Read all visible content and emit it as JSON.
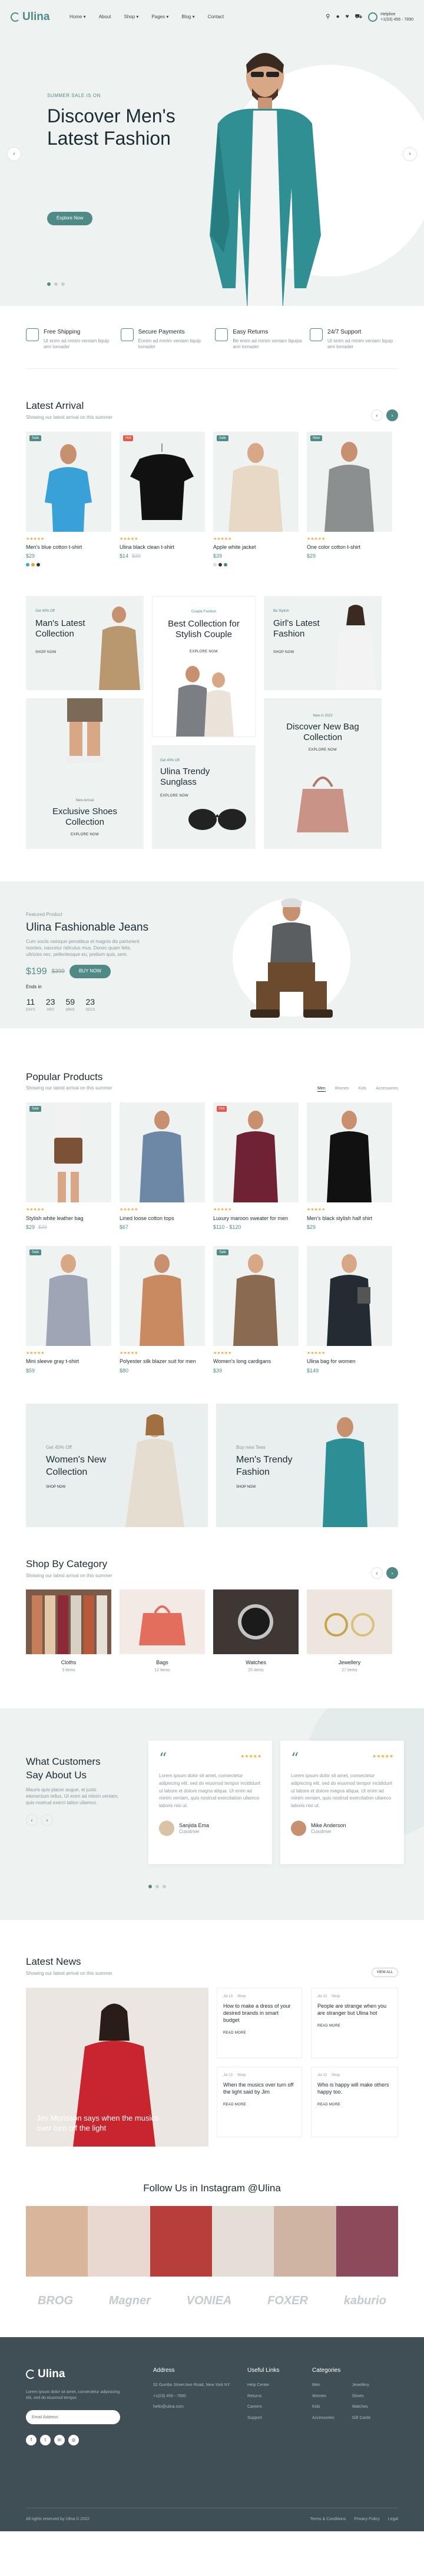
{
  "header": {
    "logo": "Ulina",
    "nav": [
      "Home ▾",
      "About",
      "Shop ▾",
      "Pages ▾",
      "Blog ▾",
      "Contact"
    ],
    "icons": [
      "search-icon",
      "user-icon",
      "heart-icon",
      "cart-icon"
    ],
    "cart_count": "0",
    "help_label": "Helpline",
    "help_phone": "+1(03) 456 - 7890"
  },
  "hero": {
    "subtitle": "SUMMER SALE IS ON",
    "title": "Discover Men's Latest Fashion",
    "button": "Explore Now"
  },
  "features": [
    {
      "title": "Free Shipping",
      "text": "Ut enim ad minim veniam liquip ami tomader"
    },
    {
      "title": "Secure Payments",
      "text": "Eonim ad minim veniam liquip tomader"
    },
    {
      "title": "Easy Returns",
      "text": "Be enim ad minim veniam liquipa ami tomader"
    },
    {
      "title": "24/7 Support",
      "text": "Ut enim ad minim veniam liquip ami tomader"
    }
  ],
  "latest": {
    "title": "Latest Arrival",
    "sub": "Showing our latest arrival on this summer",
    "products": [
      {
        "name": "Men's blue cotton t-shirt",
        "price": "$29",
        "old": "",
        "badge": "Sale",
        "badge_red": false
      },
      {
        "name": "Ulina black clean t-shirt",
        "price": "$14",
        "old": "$30",
        "badge": "Hot",
        "badge_red": true
      },
      {
        "name": "Apple white jacket",
        "price": "$39",
        "old": "",
        "badge": "Sale",
        "badge_red": false
      },
      {
        "name": "One color cotton t-shirt",
        "price": "$29",
        "old": "",
        "badge": "New",
        "badge_red": false
      }
    ]
  },
  "collections": {
    "mens_tag": "Get 40% Off",
    "mens": "Man's Latest Collection",
    "shop": "SHOP NOW",
    "couple_tag": "Couple Fashion",
    "couple": "Best Collection for Stylish Couple",
    "explore": "EXPLORE NOW",
    "girls_tag": "Be Stylish",
    "girls": "Girl's Latest Fashion",
    "shop2": "SHOP NOW",
    "shoes_tag": "New Arrival",
    "shoes": "Exclusive Shoes Collection",
    "explore2": "EXPLORE NOW",
    "sun_tag": "Get 40% Off",
    "sun": "Ulina Trendy Sunglass",
    "explore3": "EXPLORE NOW",
    "bag_tag": "New in 2022",
    "bag": "Discover New Bag Collection",
    "explore4": "EXPLORE NOW"
  },
  "jeans": {
    "tag": "Featured Product",
    "title": "Ulina Fashionable Jeans",
    "text": "Cum sociis natoque penatibus et magnis dis parturient montes, nascetur ridiculus mus. Donec quam felis, ultricies nec, pellentesque eu, pretium quis, sem.",
    "price": "$199",
    "old": "$399",
    "button": "BUY NOW",
    "ends": "Ends in",
    "cd": [
      {
        "n": "11",
        "u": "DAYS"
      },
      {
        "n": "23",
        "u": "HRS"
      },
      {
        "n": "59",
        "u": "MINS"
      },
      {
        "n": "23",
        "u": "SECS"
      }
    ]
  },
  "popular": {
    "title": "Popular Products",
    "sub": "Showing our latest arrival on this summer",
    "tabs": [
      "Men",
      "Women",
      "Kids",
      "Accessories"
    ],
    "products": [
      {
        "name": "Stylish white leather bag",
        "price": "$29",
        "old": "$39",
        "badge": "Sale",
        "badge_red": false
      },
      {
        "name": "Lined loose cotton tops",
        "price": "$67",
        "old": "",
        "badge": "",
        "badge_red": false
      },
      {
        "name": "Luxury maroon sweater for men",
        "price": "$110 - $120",
        "old": "",
        "badge": "Hot",
        "badge_red": true
      },
      {
        "name": "Men's black stylish half shirt",
        "price": "$29",
        "old": "",
        "badge": "",
        "badge_red": false
      },
      {
        "name": "Mini sleeve gray t-shirt",
        "price": "$59",
        "old": "",
        "badge": "Sale",
        "badge_red": false
      },
      {
        "name": "Polyester silk blazer suit for men",
        "price": "$80",
        "old": "",
        "badge": "",
        "badge_red": false
      },
      {
        "name": "Women's long cardigans",
        "price": "$39",
        "old": "",
        "badge": "Sale",
        "badge_red": false
      },
      {
        "name": "Ulina bag for women",
        "price": "$149",
        "old": "",
        "badge": "",
        "badge_red": false
      }
    ]
  },
  "banners": [
    {
      "tag": "Get 40% Off",
      "title": "Women's New Collection",
      "link": "SHOP NOW"
    },
    {
      "tag": "Buy new Tees",
      "title": "Men's Trendy Fashion",
      "link": "SHOP NOW"
    }
  ],
  "categories": {
    "title": "Shop By Category",
    "sub": "Showing our latest arrival on this summer",
    "items": [
      {
        "label": "Cloths",
        "sub": "3 items"
      },
      {
        "label": "Bags",
        "sub": "12 items"
      },
      {
        "label": "Watches",
        "sub": "25 items"
      },
      {
        "label": "Jewellery",
        "sub": "27 items"
      }
    ]
  },
  "testimonials": {
    "title": "What Customers Say About Us",
    "text": "Mauris quis placer augue, et justo elementum tellus. Ut enim ad minim veniam, quis nostrud exerci tation ullamco.",
    "items": [
      {
        "text": "Lorem ipsum dolor sit amet, consectetur adipiscing elit, sed do eiusmod tempor incididunt ut labore et dolore magna aliqua. Ut enim ad minim veniam, quis nostrud exercitation ullamco laboris nisi ut.",
        "name": "Sanjida Ema",
        "role": "Cusotmer"
      },
      {
        "text": "Lorem ipsum dolor sit amet, consectetur adipiscing elit, sed do eiusmod tempor incididunt ut labore et dolore magna aliqua. Ut enim ad minim veniam, quis nostrud exercitation ullamco laboris nisi ut.",
        "name": "Mike Anderson",
        "role": "Cusotmer"
      }
    ]
  },
  "news": {
    "title": "Latest News",
    "sub": "Showing our latest arrival on this summer",
    "view": "VIEW ALL",
    "big": "Jim Morisson says when the musics over turn off the light",
    "items": [
      {
        "date": "Jul 13",
        "cat": "Shop",
        "title": "How to make a dress of your desired brands in smart budget",
        "read": "READ MORE"
      },
      {
        "date": "Jul 13",
        "cat": "Shop",
        "title": "People are strange when you are stranger but Ulina hot",
        "read": "READ MORE"
      },
      {
        "date": "Jul 13",
        "cat": "Shop",
        "title": "When the musics over turn off the light said by Jim",
        "read": "READ MORE"
      },
      {
        "date": "Jul 13",
        "cat": "Shop",
        "title": "Who is happy will make others happy too.",
        "read": "READ MORE"
      }
    ]
  },
  "instagram": {
    "title": "Follow Us in Instagram @Ulina"
  },
  "brands": [
    "BROG",
    "Magner",
    "VONIEA",
    "FOXER",
    "kaburio"
  ],
  "footer": {
    "logo": "Ulina",
    "about": "Lorem ipsum dolor sit amet, consectetur adipisicing elit, sed do eiusmod tempor.",
    "email_ph": "Email Address",
    "address_title": "Address",
    "address": [
      "32 Gumbo Street Ave Road, New York NY",
      "+1(03) 456 - 7890",
      "hello@ulina.com"
    ],
    "links_title": "Useful Links",
    "links": [
      "Help Center",
      "Returns",
      "Careers",
      "Support"
    ],
    "cats_title": "Categories",
    "cats": [
      "Men",
      "Women",
      "Kids",
      "Accessories"
    ],
    "cats2": [
      "Jewellery",
      "Shoes",
      "Watches",
      "Gift Cards"
    ],
    "copyright": "All rights reserved by Ulina © 2022",
    "bottom_links": [
      "Terms & Conditions",
      "Privacy Policy",
      "Legal"
    ]
  }
}
